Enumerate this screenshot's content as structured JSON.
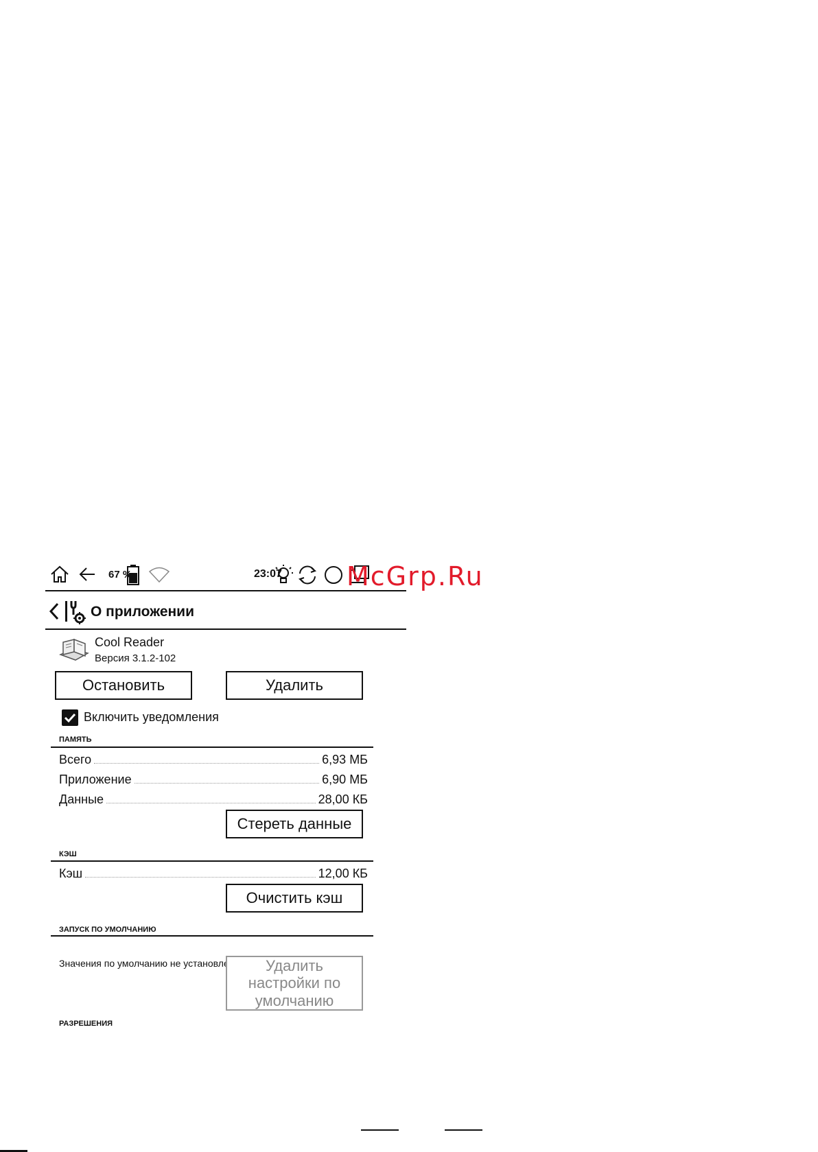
{
  "status_bar": {
    "battery": "67 %",
    "time": "23:07",
    "icons": [
      "home-icon",
      "back-arrow-icon",
      "battery-icon",
      "wifi-icon",
      "light-icon",
      "sync-icon",
      "circle-icon",
      "window-icon"
    ]
  },
  "watermark": "McGrp.Ru",
  "header": {
    "title": "О приложении"
  },
  "app": {
    "name": "Cool Reader",
    "version": "Версия 3.1.2-102"
  },
  "buttons": {
    "stop": "Остановить",
    "uninstall": "Удалить",
    "clear_data": "Стереть данные",
    "clear_cache": "Очистить кэш",
    "clear_defaults": "Удалить настройки по умолчанию"
  },
  "notifications": {
    "label": "Включить уведомления",
    "checked": true
  },
  "storage": {
    "section": "ПАМЯТЬ",
    "rows": [
      {
        "label": "Всего",
        "value": "6,93 МБ"
      },
      {
        "label": "Приложение",
        "value": "6,90 МБ"
      },
      {
        "label": "Данные",
        "value": "28,00 КБ"
      }
    ]
  },
  "cache": {
    "section": "КЭШ",
    "rows": [
      {
        "label": "Кэш",
        "value": "12,00 КБ"
      }
    ]
  },
  "defaults": {
    "section": "ЗАПУСК ПО УМОЛЧАНИЮ",
    "note": "Значения по умолчанию не установлены."
  },
  "permissions": {
    "section": "РАЗРЕШЕНИЯ"
  }
}
